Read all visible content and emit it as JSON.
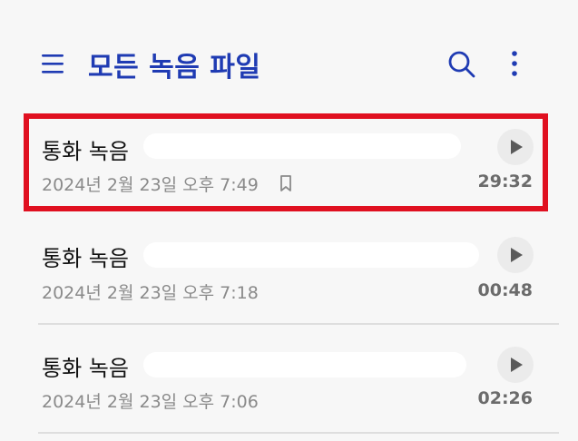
{
  "header": {
    "title": "모든 녹음 파일",
    "menu_icon": "hamburger-menu-icon",
    "search_icon": "search-icon",
    "more_icon": "more-vertical-icon",
    "accent_color": "#1f3bb3"
  },
  "recordings": [
    {
      "title": "통화 녹음",
      "date": "2024년 2월 23일 오후 7:49",
      "duration": "29:32",
      "bookmarked": true,
      "highlighted": true
    },
    {
      "title": "통화 녹음",
      "date": "2024년 2월 23일 오후 7:18",
      "duration": "00:48",
      "bookmarked": false,
      "highlighted": false
    },
    {
      "title": "통화 녹음",
      "date": "2024년 2월 23일 오후 7:06",
      "duration": "02:26",
      "bookmarked": false,
      "highlighted": false
    }
  ],
  "highlight_color": "#e01020"
}
